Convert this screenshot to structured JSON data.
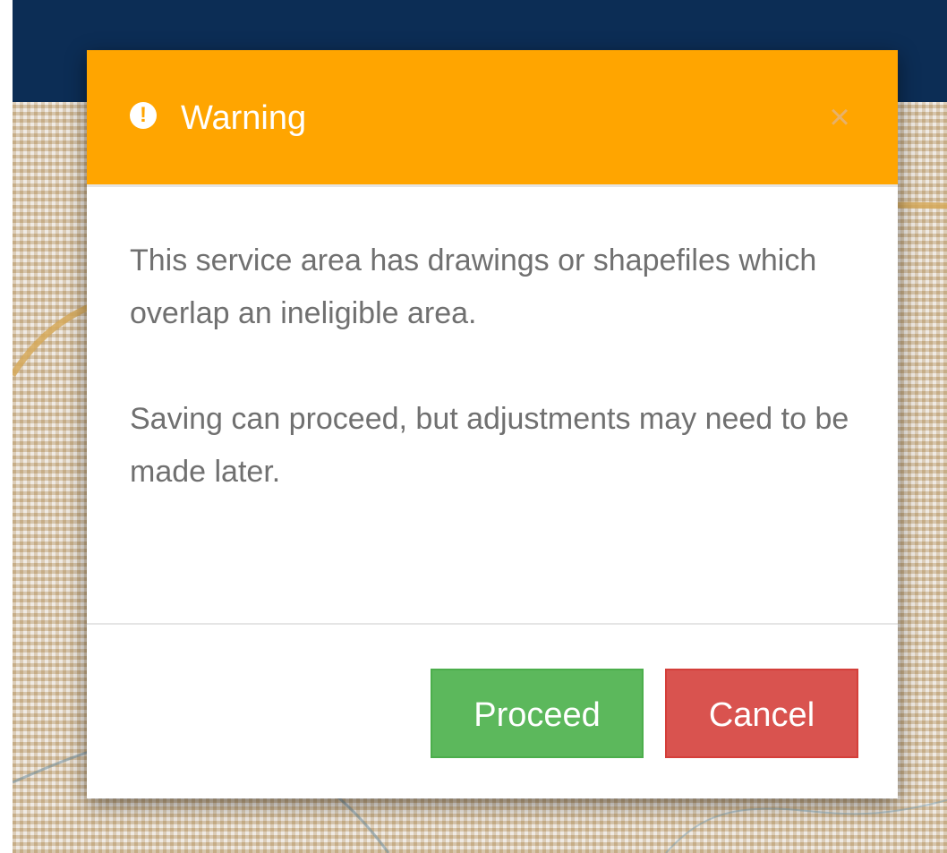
{
  "colors": {
    "header_background": "#ffa500",
    "topbar_background": "#0c2d55",
    "proceed_background": "#5cb85c",
    "cancel_background": "#d9534f",
    "body_text": "#707070"
  },
  "icons": {
    "warning": "exclamation-circle-icon",
    "close": "close-icon"
  },
  "modal": {
    "title": "Warning",
    "close_glyph": "×",
    "warning_glyph": "!",
    "body": {
      "message_1": "This service area has drawings or shapefiles which overlap an ineligible area.",
      "message_2": "Saving can proceed, but adjustments may need to be made later."
    },
    "buttons": {
      "proceed": "Proceed",
      "cancel": "Cancel"
    }
  }
}
